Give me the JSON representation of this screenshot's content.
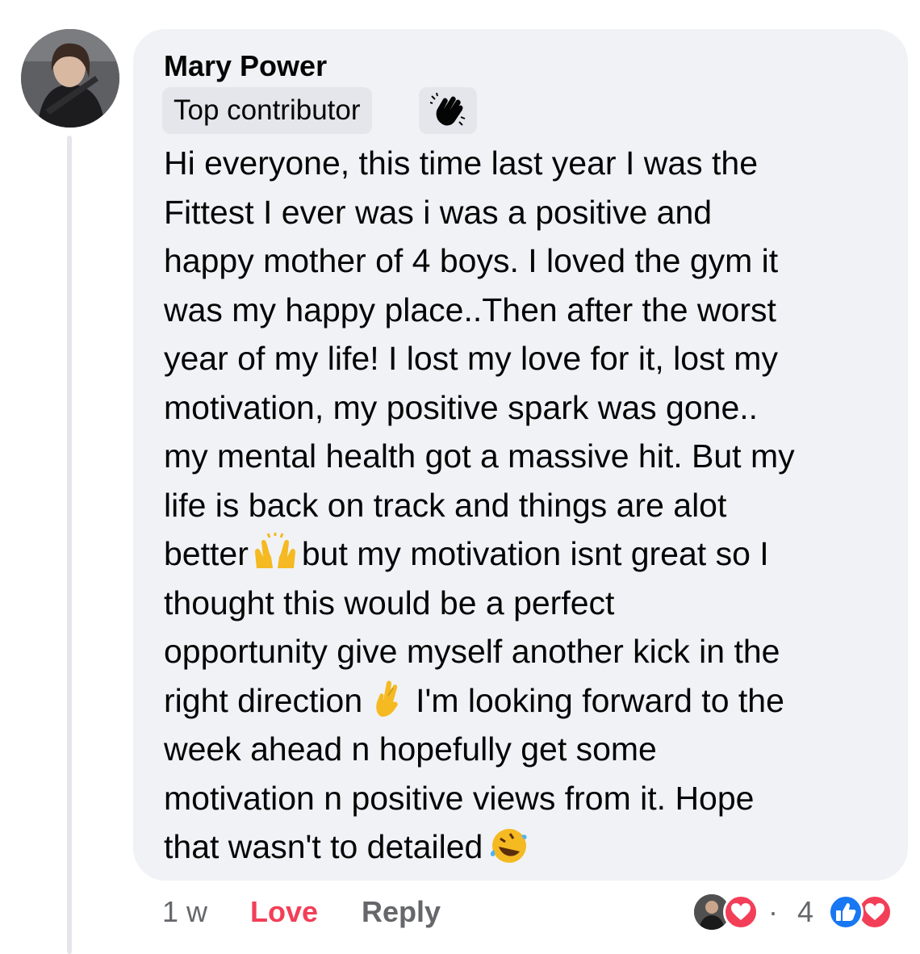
{
  "comment": {
    "author": "Mary Power",
    "badge": "Top contributor",
    "badge_icon": "wave-hand-icon",
    "lines": [
      [
        "Hi everyone, this time last year I was the"
      ],
      [
        "Fittest I ever was i was a positive and"
      ],
      [
        "happy mother of 4 boys. I loved the gym it"
      ],
      [
        "was my happy place..Then after the worst"
      ],
      [
        "year of my life! I lost my love for it, lost my"
      ],
      [
        "motivation, my positive spark was gone.."
      ],
      [
        "my mental health got a massive hit. But my"
      ],
      [
        "life is back on track and things are alot"
      ],
      [
        "better",
        "but my motivation isnt great so I"
      ],
      [
        "thought this would be a perfect"
      ],
      [
        "opportunity give myself another kick in the"
      ],
      [
        "right direction",
        "I'm looking forward to the"
      ],
      [
        "week ahead n hopefully get some"
      ],
      [
        "motivation n positive views from it. Hope"
      ],
      [
        "that wasn't to detailed"
      ]
    ],
    "emojis": {
      "raised_hands": "raising-hands-emoji",
      "crossed_fingers": "crossed-fingers-emoji",
      "laughing": "rolling-laughing-emoji"
    }
  },
  "meta": {
    "time": "1 w",
    "love_label": "Love",
    "reply_label": "Reply"
  },
  "reactions": {
    "separator": "·",
    "count": "4",
    "types": [
      "love",
      "like",
      "love"
    ]
  },
  "colors": {
    "bubble": "#f0f2f5",
    "badge": "#e4e6eb",
    "love": "#f33e58",
    "like": "#1877f2",
    "muted": "#65676b"
  }
}
